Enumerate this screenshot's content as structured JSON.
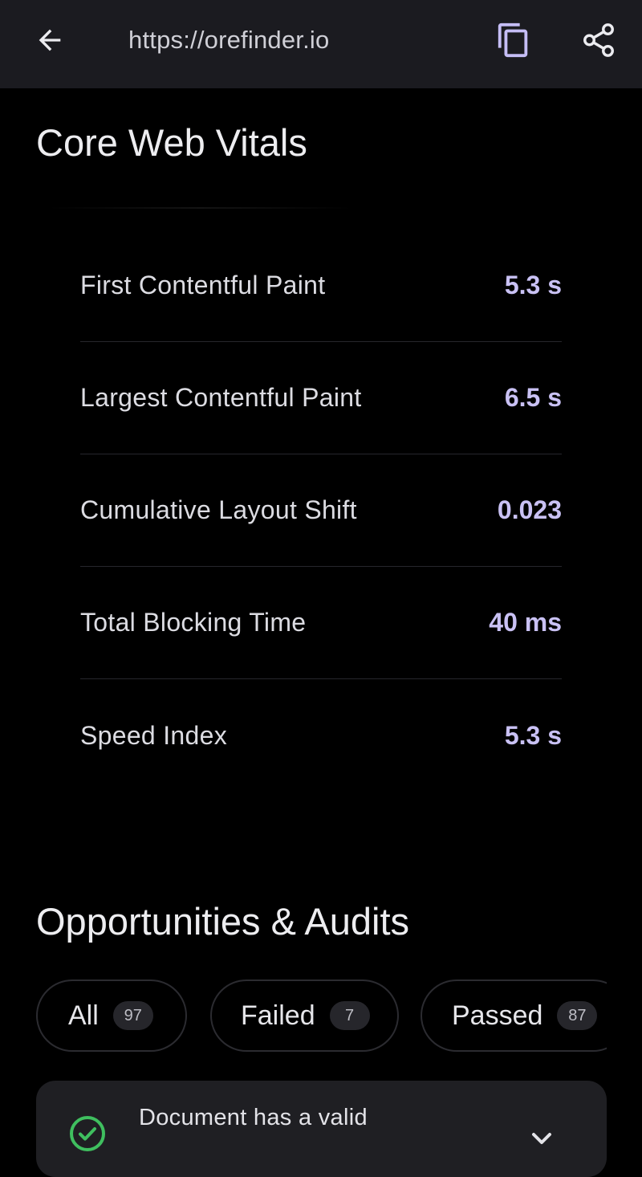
{
  "topbar": {
    "url": "https://orefinder.io",
    "icons": {
      "back": "arrow-left-icon",
      "copy": "copy-icon",
      "share": "share-icon"
    }
  },
  "core_web_vitals": {
    "title": "Core Web Vitals",
    "metrics": [
      {
        "label": "First Contentful Paint",
        "value": "5.3 s"
      },
      {
        "label": "Largest Contentful Paint",
        "value": "6.5 s"
      },
      {
        "label": "Cumulative Layout Shift",
        "value": "0.023"
      },
      {
        "label": "Total Blocking Time",
        "value": "40 ms"
      },
      {
        "label": "Speed Index",
        "value": "5.3 s"
      }
    ]
  },
  "audits": {
    "title": "Opportunities & Audits",
    "filters": [
      {
        "label": "All",
        "count": "97"
      },
      {
        "label": "Failed",
        "count": "7"
      },
      {
        "label": "Passed",
        "count": "87"
      }
    ],
    "items": [
      {
        "text": "Document has a valid",
        "status_icon": "check-circle-icon",
        "expand_icon": "chevron-down-icon"
      }
    ]
  },
  "colors": {
    "background": "#000000",
    "topbar": "#1b1b20",
    "accent_value": "#c9c1f4",
    "icon_accent": "#c5bdf5",
    "pass_green": "#3fbf5f",
    "card": "#1f1f23"
  }
}
